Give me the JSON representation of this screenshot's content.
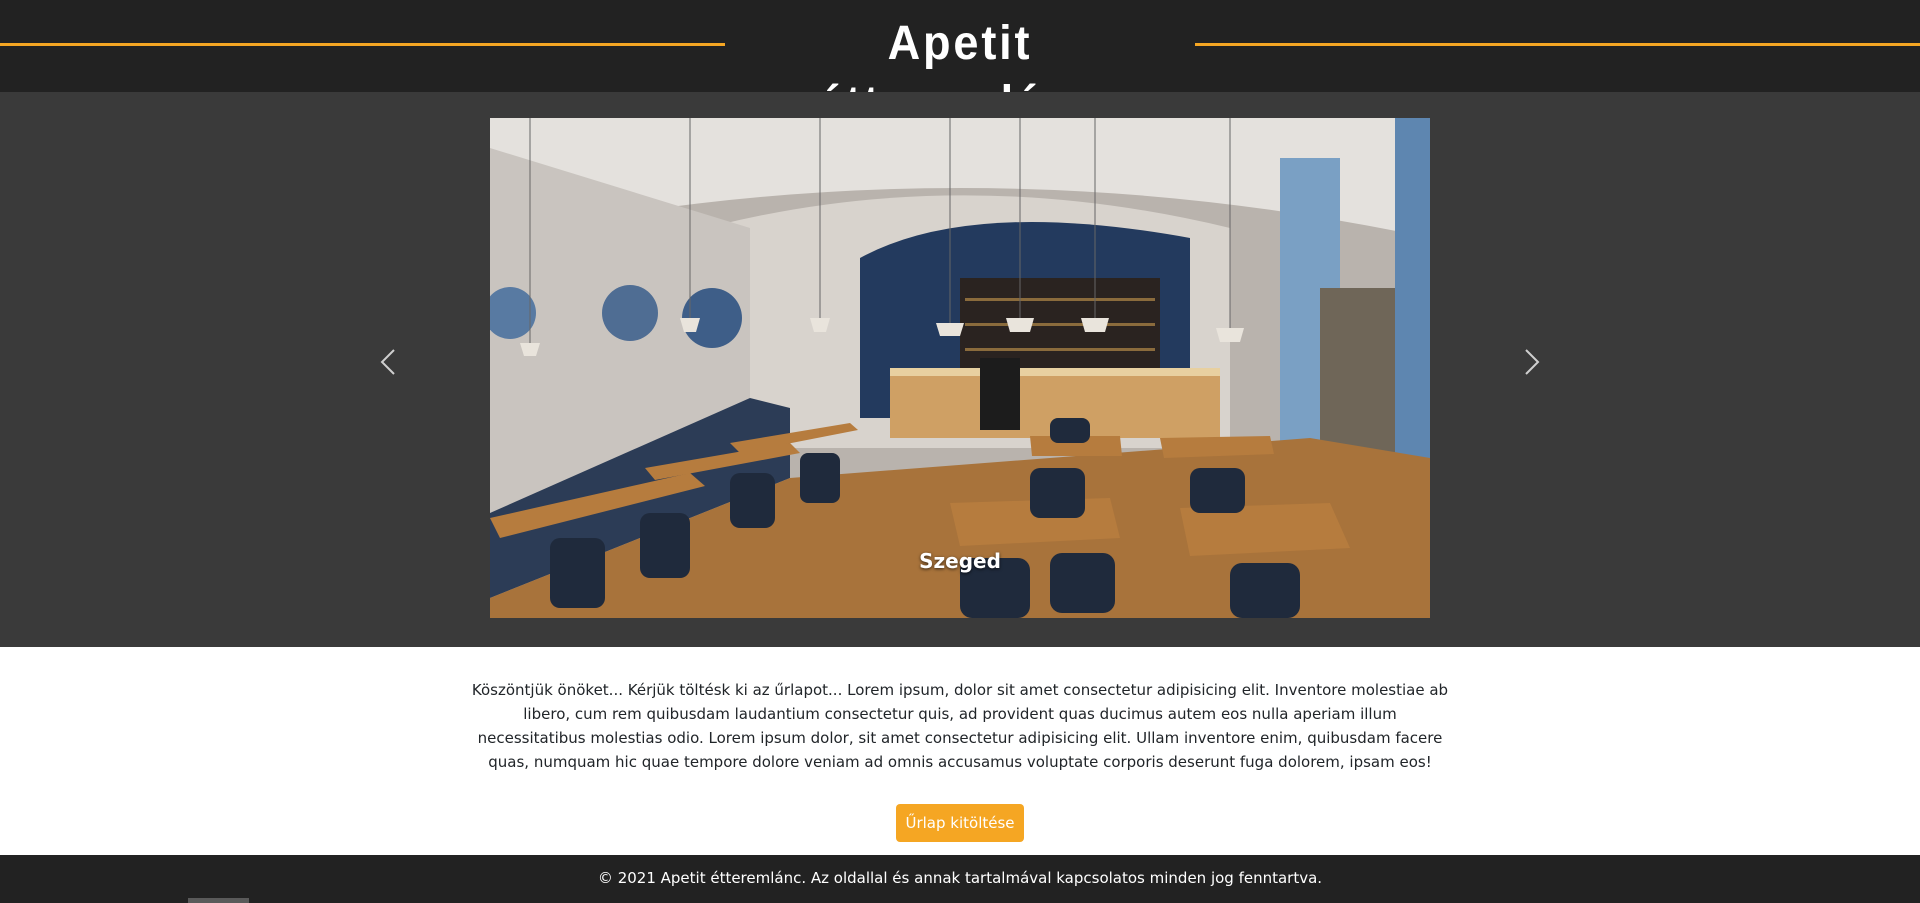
{
  "header": {
    "title": "Apetit étteremlánc",
    "accent_color": "#f5a623"
  },
  "carousel": {
    "prev_icon": "chevron-left-icon",
    "next_icon": "chevron-right-icon",
    "slides": [
      {
        "caption": "Szeged"
      }
    ]
  },
  "intro": {
    "text": "Köszöntjük önöket... Kérjük töltésk ki az űrlapot... Lorem ipsum, dolor sit amet consectetur adipisicing elit. Inventore molestiae ab libero, cum rem quibusdam laudantium consectetur quis, ad provident quas ducimus autem eos nulla aperiam illum necessitatibus molestias odio. Lorem ipsum dolor, sit amet consectetur adipisicing elit. Ullam inventore enim, quibusdam facere quas, numquam hic quae tempore dolore veniam ad omnis accusamus voluptate corporis deserunt fuga dolorem, ipsam eos!",
    "button_label": "Űrlap kitöltése"
  },
  "footer": {
    "text": "© 2021 Apetit étteremlánc. Az oldallal és annak tartalmával kapcsolatos minden jog fenntartva."
  }
}
